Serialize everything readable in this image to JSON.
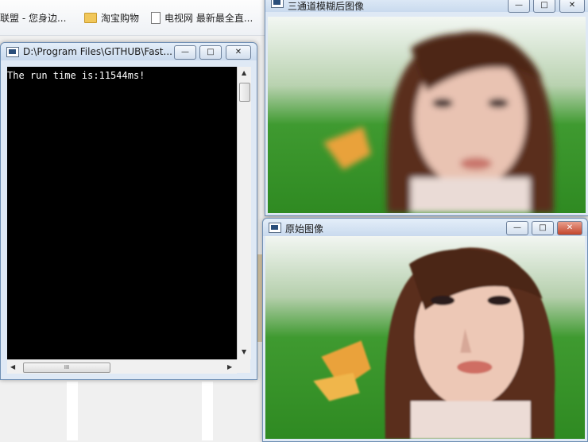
{
  "browser": {
    "bookmarks": [
      {
        "label": "联盟 - 您身边...",
        "icon": "none"
      },
      {
        "label": "淘宝购物",
        "icon": "folder-icon"
      },
      {
        "label": "电视网 最新最全直...",
        "icon": "page-icon"
      }
    ]
  },
  "console_window": {
    "title": "D:\\Program Files\\GITHUB\\Fast...",
    "output_lines": [
      "The run time is:11544ms!"
    ],
    "buttons": {
      "minimize": "—",
      "maximize": "□",
      "close": "✕"
    },
    "scroll_thumb_grip": "III"
  },
  "blurred_window": {
    "title": "三通道模糊后图像",
    "buttons": {
      "minimize": "—",
      "maximize": "□",
      "close": "✕"
    },
    "image_icon": "photo-blurred-portrait"
  },
  "original_window": {
    "title": "原始图像",
    "buttons": {
      "minimize": "—",
      "maximize": "□",
      "close": "✕"
    },
    "image_icon": "photo-original-portrait"
  },
  "colors": {
    "console_bg": "#000000",
    "console_text": "#ffffff",
    "close_red": "#c2452b",
    "titlebar": "#c9daee"
  }
}
